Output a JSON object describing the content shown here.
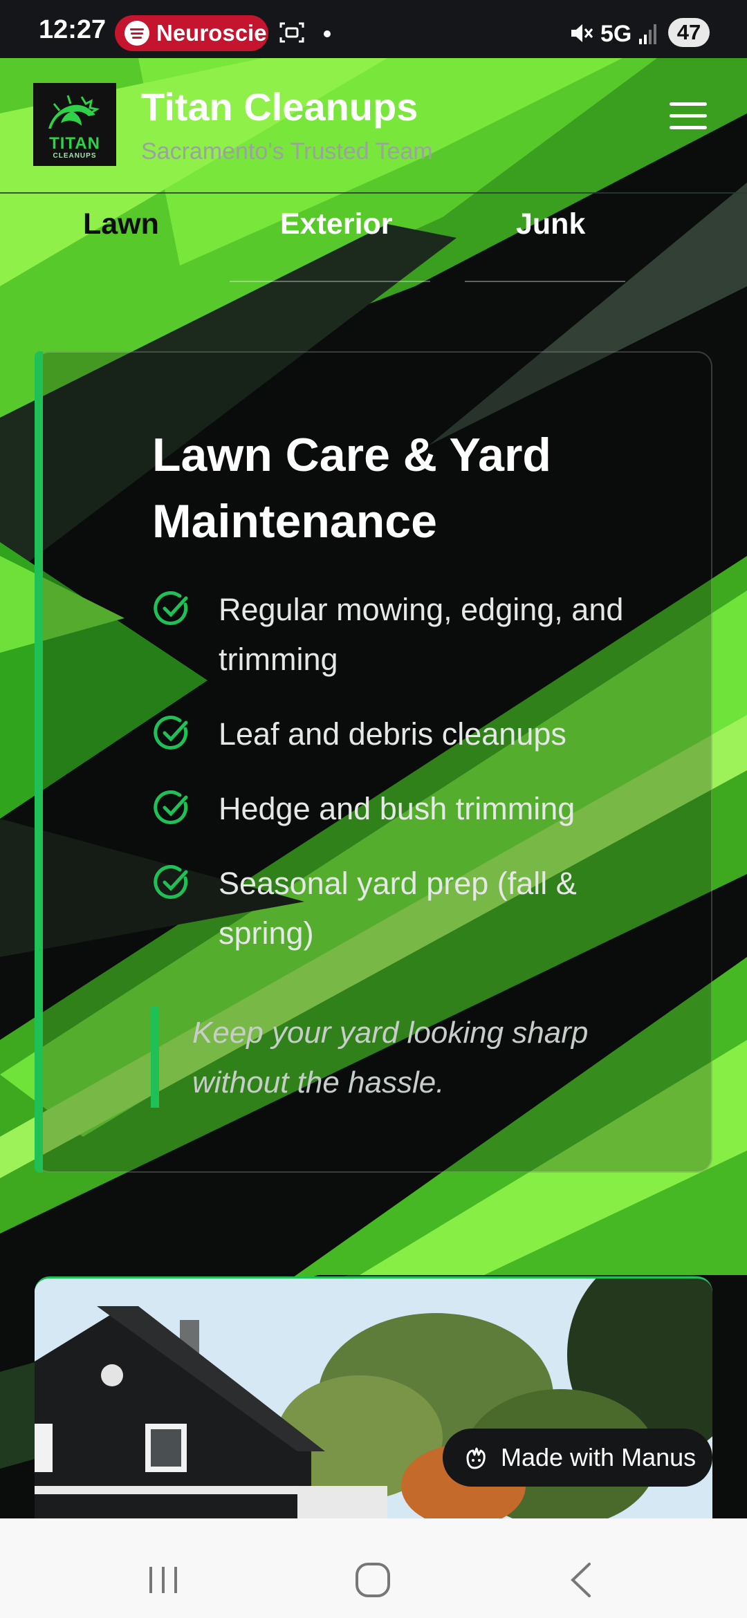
{
  "status_bar": {
    "time": "12:27",
    "media_app": "Neuroscie",
    "network": "5G",
    "battery": "47"
  },
  "header": {
    "logo_text": "TITAN",
    "logo_subtext": "CLEANUPS",
    "title": "Titan Cleanups",
    "tagline": "Sacramento's Trusted Team",
    "menu_icon": "hamburger-menu-icon"
  },
  "tabs": [
    {
      "label": "Lawn",
      "active": true
    },
    {
      "label": "Exterior",
      "active": false
    },
    {
      "label": "Junk",
      "active": false
    }
  ],
  "service": {
    "title_line1": "Lawn Care & Yard",
    "title_line2": "Maintenance",
    "features": [
      {
        "line1": "Regular mowing, edging, and",
        "line2": "trimming"
      },
      {
        "line1": "Leaf and debris cleanups",
        "line2": ""
      },
      {
        "line1": "Hedge and bush trimming",
        "line2": ""
      },
      {
        "line1": "Seasonal yard prep (fall &",
        "line2": "spring)"
      }
    ],
    "quote_line1": "Keep your yard looking sharp",
    "quote_line2": "without the hassle."
  },
  "badge": {
    "label": "Made with Manus",
    "icon": "manus-hand-icon"
  },
  "colors": {
    "accent_green": "#1fc056",
    "bright_green": "#7ff03a",
    "spotify_pill": "#c5142d"
  }
}
